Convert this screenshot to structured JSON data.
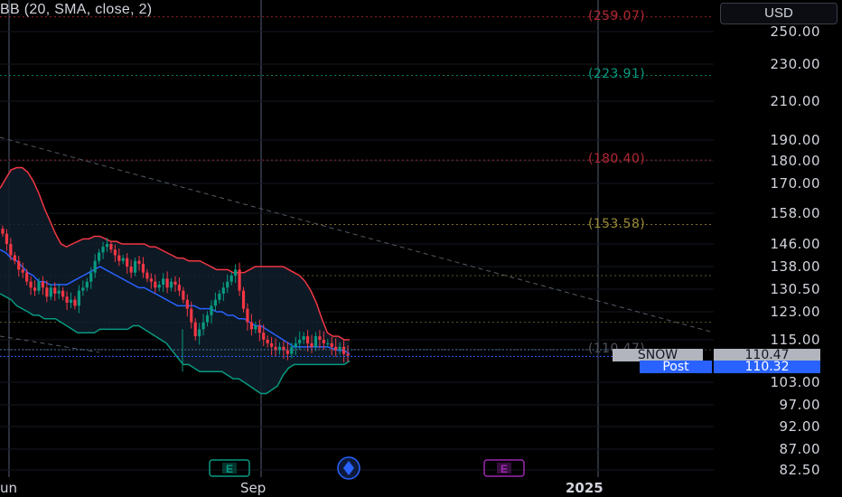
{
  "indicator": {
    "label": "BB (20, SMA, close, 2)"
  },
  "currency": "USD",
  "price_axis": {
    "ticks": [
      {
        "label": "250.00",
        "value": 250
      },
      {
        "label": "230.00",
        "value": 230
      },
      {
        "label": "210.00",
        "value": 210
      },
      {
        "label": "190.00",
        "value": 190
      },
      {
        "label": "180.00",
        "value": 180
      },
      {
        "label": "170.00",
        "value": 170
      },
      {
        "label": "158.00",
        "value": 158
      },
      {
        "label": "146.00",
        "value": 146
      },
      {
        "label": "138.00",
        "value": 138
      },
      {
        "label": "130.50",
        "value": 130.5
      },
      {
        "label": "123.00",
        "value": 123
      },
      {
        "label": "115.00",
        "value": 115
      },
      {
        "label": "103.00",
        "value": 103
      },
      {
        "label": "97.00",
        "value": 97
      },
      {
        "label": "92.00",
        "value": 92
      },
      {
        "label": "87.00",
        "value": 87
      },
      {
        "label": "82.50",
        "value": 82.5
      }
    ]
  },
  "fib_levels": [
    {
      "label": "(259.07)",
      "value": 259.07,
      "color": "#b22833"
    },
    {
      "label": "(223.91)",
      "value": 223.91,
      "color": "#089981"
    },
    {
      "label": "(180.40)",
      "value": 180.4,
      "color": "#b22833"
    },
    {
      "label": "(153.58)",
      "value": 153.58,
      "color": "#9a8a3a"
    },
    {
      "label": "(110.47)",
      "value": 112.2,
      "color": "#50535e"
    }
  ],
  "badges": {
    "symbol": {
      "name": "SNOW",
      "price": "110.47"
    },
    "post": {
      "name": "Post",
      "price": "110.32"
    }
  },
  "time_axis": {
    "labels": [
      "un",
      "Sep",
      "2025"
    ]
  },
  "event_markers": [
    {
      "type": "earnings",
      "label": "E",
      "color": "#089981"
    },
    {
      "type": "dividend",
      "label": "◆",
      "color": "#2962ff"
    },
    {
      "type": "earnings",
      "label": "E",
      "color": "#9c27b0"
    }
  ],
  "colors": {
    "upper_band": "#f23645",
    "lower_band": "#089981",
    "basis": "#2962ff",
    "up_candle": "#089981",
    "down_candle": "#f23645"
  },
  "chart_data": {
    "type": "candlestick",
    "symbol": "SNOW",
    "last_price": 110.47,
    "post_price": 110.32,
    "ylim": [
      82.5,
      259
    ],
    "close_series": [
      150,
      146,
      142,
      140,
      137,
      136,
      133,
      131,
      130,
      133,
      131,
      128,
      131,
      129,
      130,
      128,
      126,
      127,
      125,
      130,
      131,
      133,
      136,
      140,
      143,
      145,
      146,
      144,
      142,
      140,
      141,
      138,
      136,
      140,
      139,
      136,
      134,
      133,
      131,
      132,
      134,
      131,
      133,
      132,
      130,
      127,
      124,
      120,
      116,
      118,
      120,
      122,
      125,
      127,
      129,
      131,
      133,
      135,
      137,
      130,
      124,
      120,
      118,
      119,
      117,
      115,
      114,
      113,
      112,
      113,
      112,
      111,
      113,
      114,
      115,
      116,
      114,
      113,
      116,
      115,
      114,
      114,
      113,
      112,
      113,
      111,
      110.47
    ],
    "upper_band": [
      168,
      172,
      176,
      177,
      177,
      175,
      171,
      166,
      160,
      155,
      150,
      146,
      145,
      146,
      147,
      148,
      148,
      149,
      149,
      148,
      147,
      147,
      146,
      146,
      146,
      146,
      146,
      145,
      145,
      144,
      143,
      142,
      141,
      141,
      140,
      140,
      140,
      139,
      138,
      137,
      137,
      137,
      136,
      136,
      136,
      137,
      138,
      138,
      138,
      138,
      138,
      138,
      137,
      136,
      135,
      133,
      130,
      126,
      121,
      117,
      116,
      116,
      115,
      115
    ],
    "basis": [
      144,
      143,
      141,
      140,
      138,
      136,
      135,
      133,
      133,
      132,
      132,
      132,
      132,
      133,
      134,
      135,
      136,
      137,
      138,
      137,
      136,
      135,
      134,
      133,
      132,
      131,
      131,
      130,
      129,
      128,
      127,
      126,
      125,
      125,
      125,
      125,
      124,
      124,
      124,
      123,
      123,
      122,
      122,
      121,
      121,
      120,
      119,
      119,
      118,
      117,
      116,
      115,
      114,
      113,
      113,
      113,
      113,
      113,
      113,
      113,
      112.5,
      112,
      112,
      111
    ],
    "lower_band": [
      129,
      128,
      127,
      125,
      124,
      123,
      122,
      122,
      121,
      121,
      121,
      120,
      119,
      118,
      117,
      117,
      117,
      117,
      118,
      118,
      118,
      118,
      118,
      118,
      119,
      119,
      118,
      117,
      116,
      115,
      114,
      112,
      110,
      108,
      108,
      107,
      106,
      106,
      106,
      106,
      106,
      105,
      104,
      104,
      103,
      102,
      101,
      100,
      100,
      101,
      102,
      105,
      107,
      108,
      108,
      108,
      108,
      108,
      108,
      108,
      108,
      108,
      108,
      109
    ]
  }
}
